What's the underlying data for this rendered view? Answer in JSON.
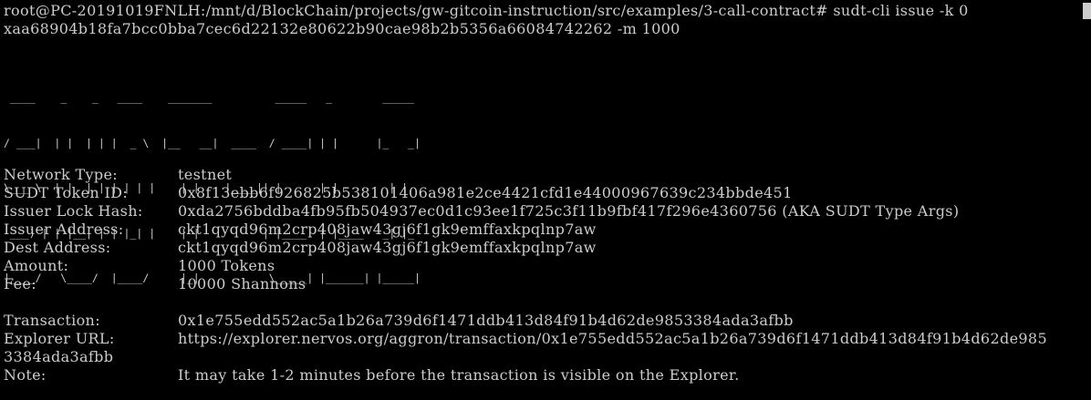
{
  "terminal": {
    "command_line_1": "root@PC-20191019FNLH:/mnt/d/BlockChain/projects/gw-gitcoin-instruction/src/examples/3-call-contract# sudt-cli issue -k 0",
    "command_line_2": "xaa68904b18fa7bcc0bba7cec6d22132e80622b90cae98b2b5356a66084742262 -m 1000",
    "banner_text": "SUDT-CLI",
    "banner_lines": [
      " ____    _    _   ____    _______          _____   _        _____ ",
      "/ ___|  | |  | | |  _ \\  |__   __|  ____  / ____| | |      |_   _|",
      "\\___ \\  | |  | | | | | |    | |    |____|| |      | |        | |  ",
      " ___) | | |__| | | |_| |    | |          | |____  | |____   _| |_ ",
      "|____/   \\____/  |____/     |_|           \\_____| |______| |_____|"
    ],
    "fields": [
      {
        "label": "Network Type:",
        "value": "testnet"
      },
      {
        "label": "SUDT Token ID:",
        "value": "0x8f13ebb6f926825b538101406a981e2ce4421cfd1e44000967639c234bbde451"
      },
      {
        "label": "Issuer Lock Hash:",
        "value": "0xda2756bddba4fb95fb504937ec0d1c93ee1f725c3f11b9fbf417f296e4360756 (AKA SUDT Type Args)"
      },
      {
        "label": "Issuer Address:",
        "value": "ckt1qyqd96m2crp408jaw43gj6f1gk9emffaxkpqlnp7aw"
      },
      {
        "label": "Dest Address:",
        "value": "ckt1qyqd96m2crp408jaw43gj6f1gk9emffaxkpqlnp7aw"
      },
      {
        "label": "Amount:",
        "value": "1000 Tokens"
      },
      {
        "label": "Fee:",
        "value": "10000 Shannons"
      }
    ],
    "transaction": {
      "label": "Transaction:",
      "value": "0x1e755edd552ac5a1b26a739d6f1471ddb413d84f91b4d62de9853384ada3afbb"
    },
    "explorer": {
      "label": "Explorer URL:",
      "value": "https://explorer.nervos.org/aggron/transaction/0x1e755edd552ac5a1b26a739d6f1471ddb413d84f91b4d62de985",
      "wrap": "3384ada3afbb"
    },
    "note": {
      "label": "Note:",
      "value": "It may take 1-2 minutes before the transaction is visible on the Explorer."
    }
  }
}
